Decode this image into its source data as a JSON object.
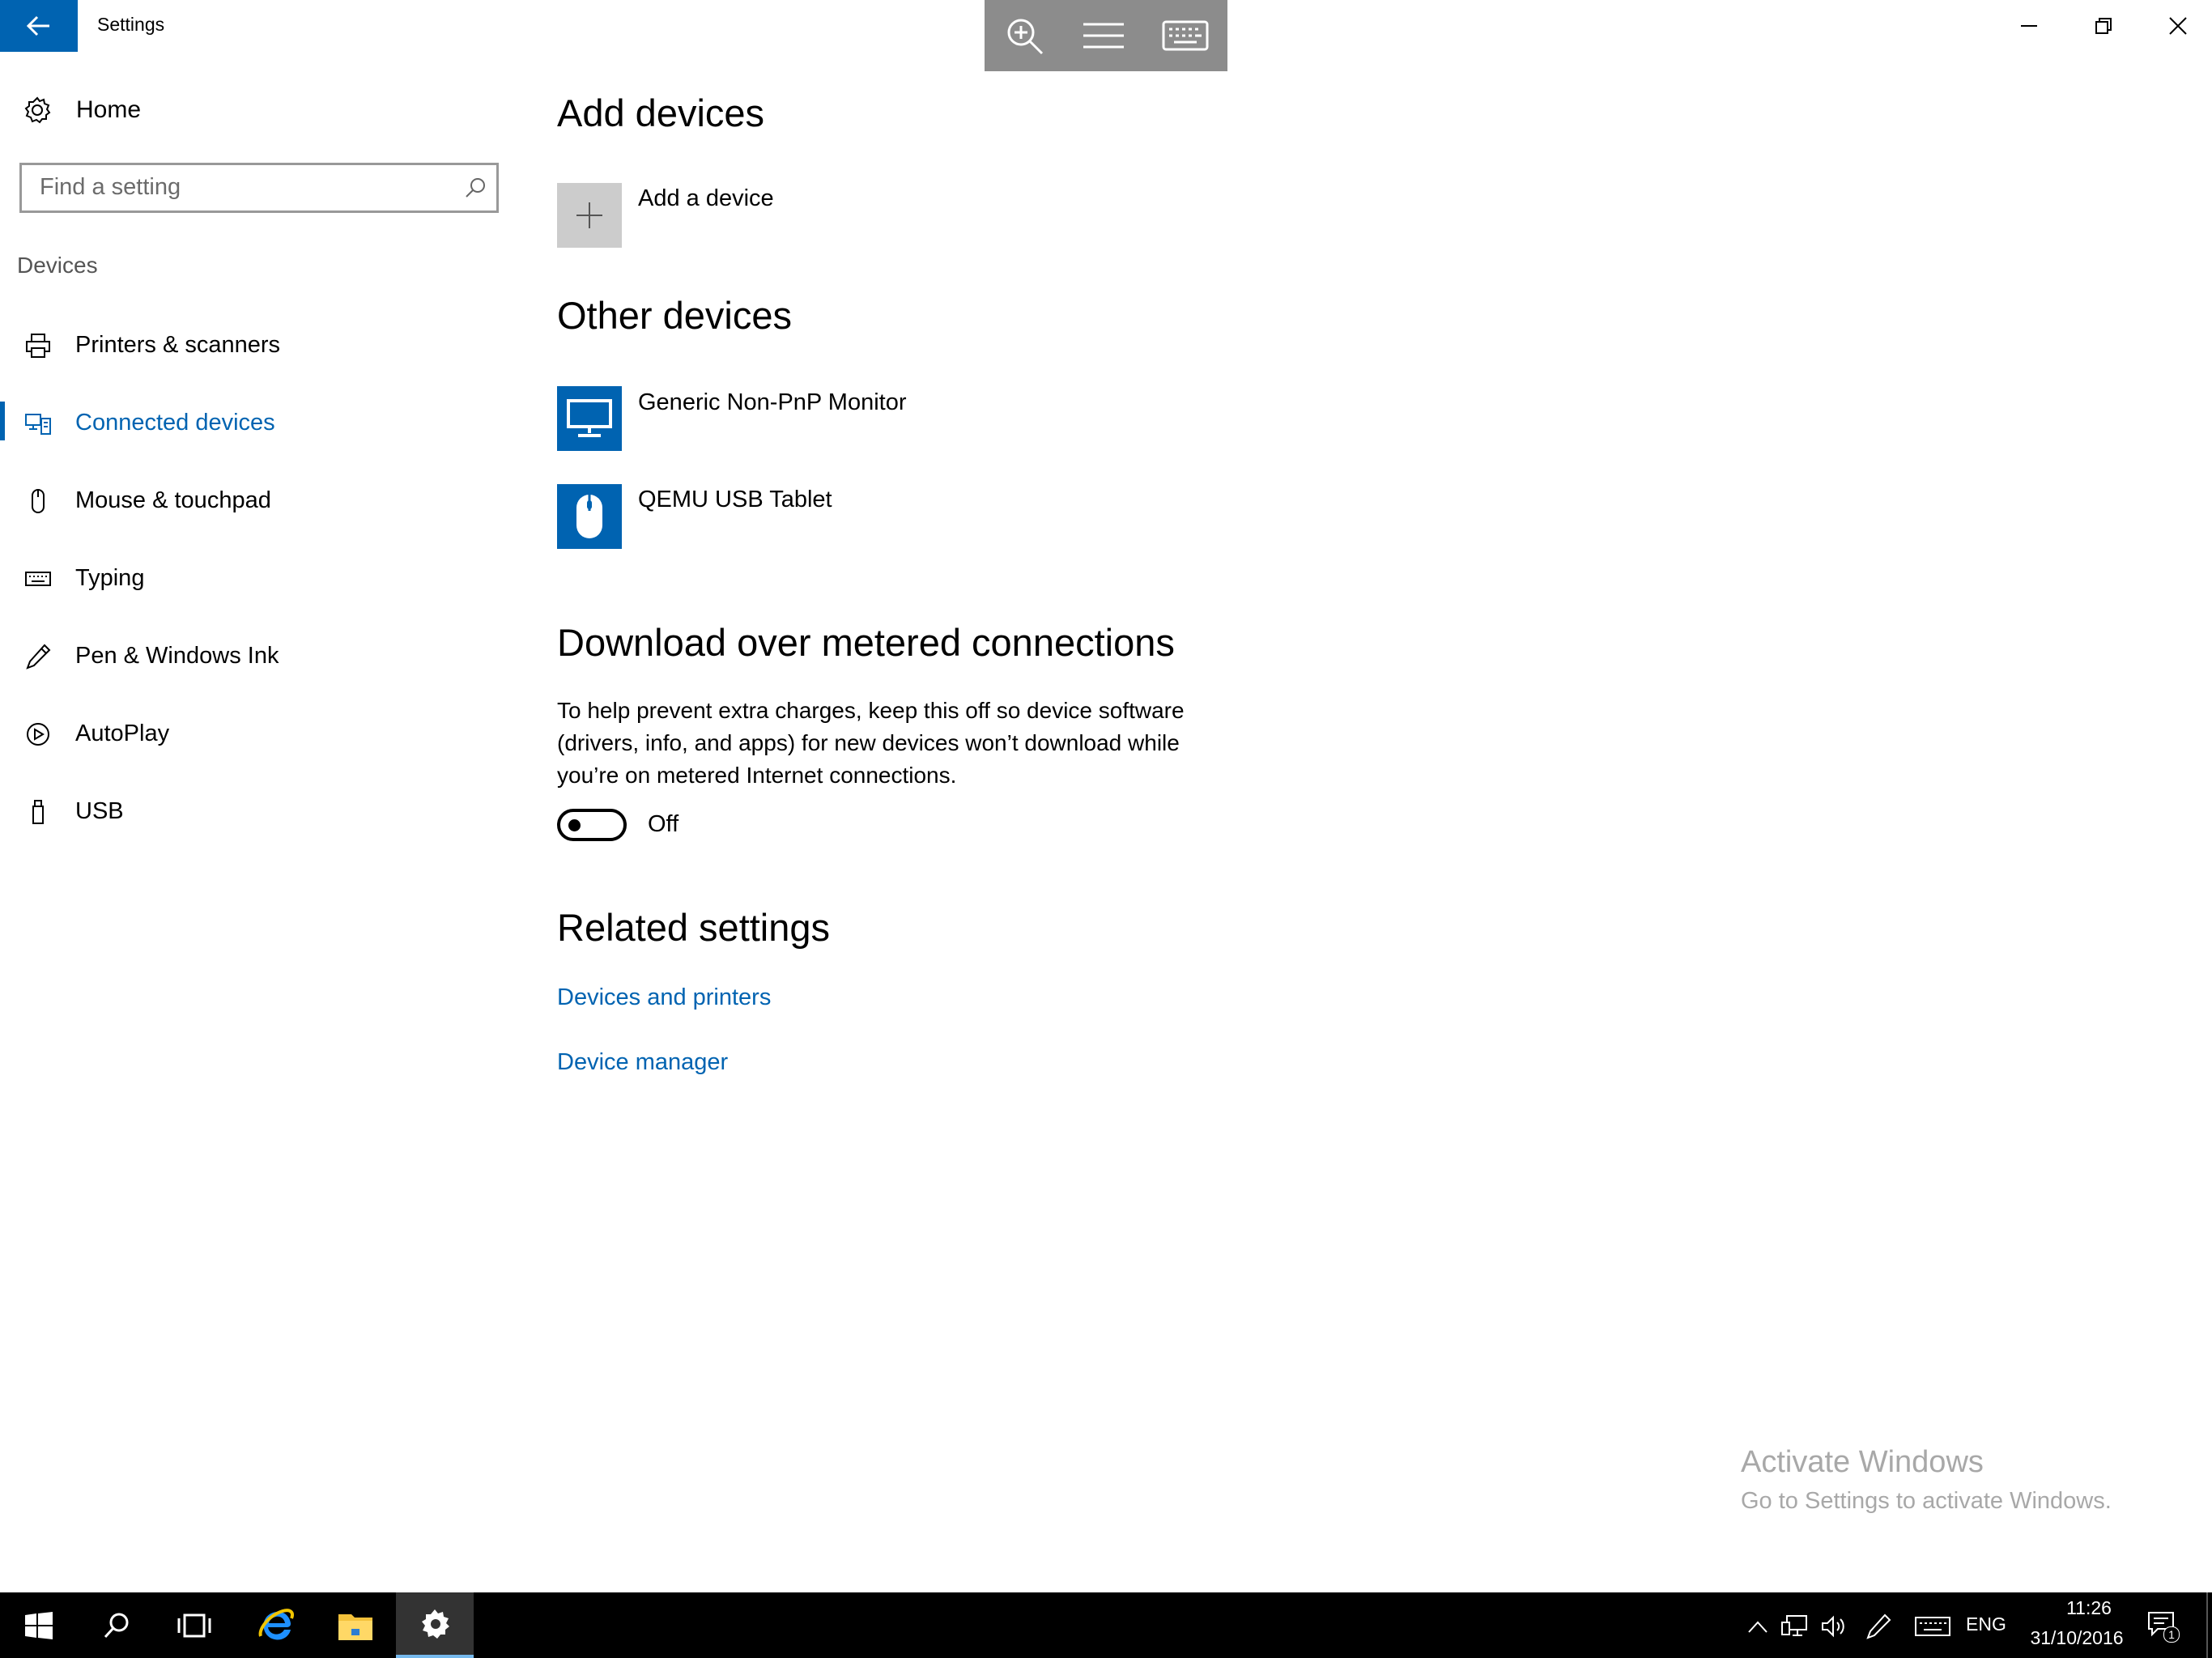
{
  "window": {
    "title": "Settings"
  },
  "sidebar": {
    "home_label": "Home",
    "search_placeholder": "Find a setting",
    "group_title": "Devices",
    "items": [
      {
        "label": "Printers & scanners",
        "icon": "printer-icon"
      },
      {
        "label": "Connected devices",
        "icon": "connected-devices-icon",
        "active": true
      },
      {
        "label": "Mouse & touchpad",
        "icon": "mouse-icon"
      },
      {
        "label": "Typing",
        "icon": "keyboard-icon"
      },
      {
        "label": "Pen & Windows Ink",
        "icon": "pen-icon"
      },
      {
        "label": "AutoPlay",
        "icon": "autoplay-icon"
      },
      {
        "label": "USB",
        "icon": "usb-icon"
      }
    ]
  },
  "main": {
    "add_devices": {
      "heading": "Add devices",
      "add_label": "Add a device"
    },
    "other_devices": {
      "heading": "Other devices",
      "devices": [
        {
          "name": "Generic Non-PnP Monitor",
          "icon": "monitor-icon"
        },
        {
          "name": "QEMU USB Tablet",
          "icon": "mouse-icon"
        }
      ]
    },
    "metered": {
      "heading": "Download over metered connections",
      "description": "To help prevent extra charges, keep this off so device software (drivers, info, and apps) for new devices won’t download while you’re on metered Internet connections.",
      "toggle_state": "Off"
    },
    "related": {
      "heading": "Related settings",
      "links": [
        "Devices and printers",
        "Device manager"
      ]
    }
  },
  "watermark": {
    "line1": "Activate Windows",
    "line2": "Go to Settings to activate Windows."
  },
  "taskbar": {
    "language": "ENG",
    "time": "11:26",
    "date": "31/10/2016",
    "notification_count": "1"
  },
  "colors": {
    "accent": "#0063b1",
    "taskbar": "#000000",
    "tile_gray": "#cccccc"
  }
}
